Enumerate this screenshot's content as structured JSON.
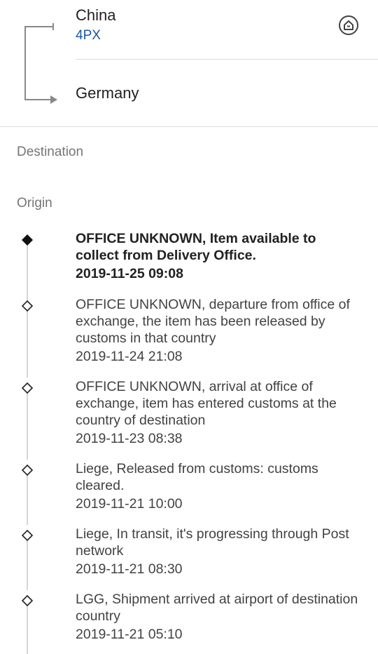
{
  "route": {
    "origin_country": "China",
    "carrier": "4PX",
    "destination_country": "Germany",
    "home_icon": "home-circle-icon"
  },
  "sections": {
    "destination_label": "Destination",
    "origin_label": "Origin"
  },
  "events": [
    {
      "description": "OFFICE UNKNOWN, Item available to collect from Delivery Office.",
      "datetime": "2019-11-25 09:08",
      "latest": true
    },
    {
      "description": "OFFICE UNKNOWN, departure from office of exchange, the item has been released by customs in that country",
      "datetime": "2019-11-24 21:08",
      "latest": false
    },
    {
      "description": "OFFICE UNKNOWN, arrival at office of exchange, item has entered customs at the country of destination",
      "datetime": "2019-11-23 08:38",
      "latest": false
    },
    {
      "description": "Liege, Released from customs: customs cleared.",
      "datetime": "2019-11-21 10:00",
      "latest": false
    },
    {
      "description": "Liege, In transit, it's progressing through Post network",
      "datetime": "2019-11-21 08:30",
      "latest": false
    },
    {
      "description": "LGG, Shipment arrived at airport of destination country",
      "datetime": "2019-11-21 05:10",
      "latest": false
    }
  ],
  "colors": {
    "carrier_link": "#1a56a6",
    "text_primary": "#212121",
    "text_secondary": "#757575",
    "timeline_line": "#d5d5d5"
  }
}
